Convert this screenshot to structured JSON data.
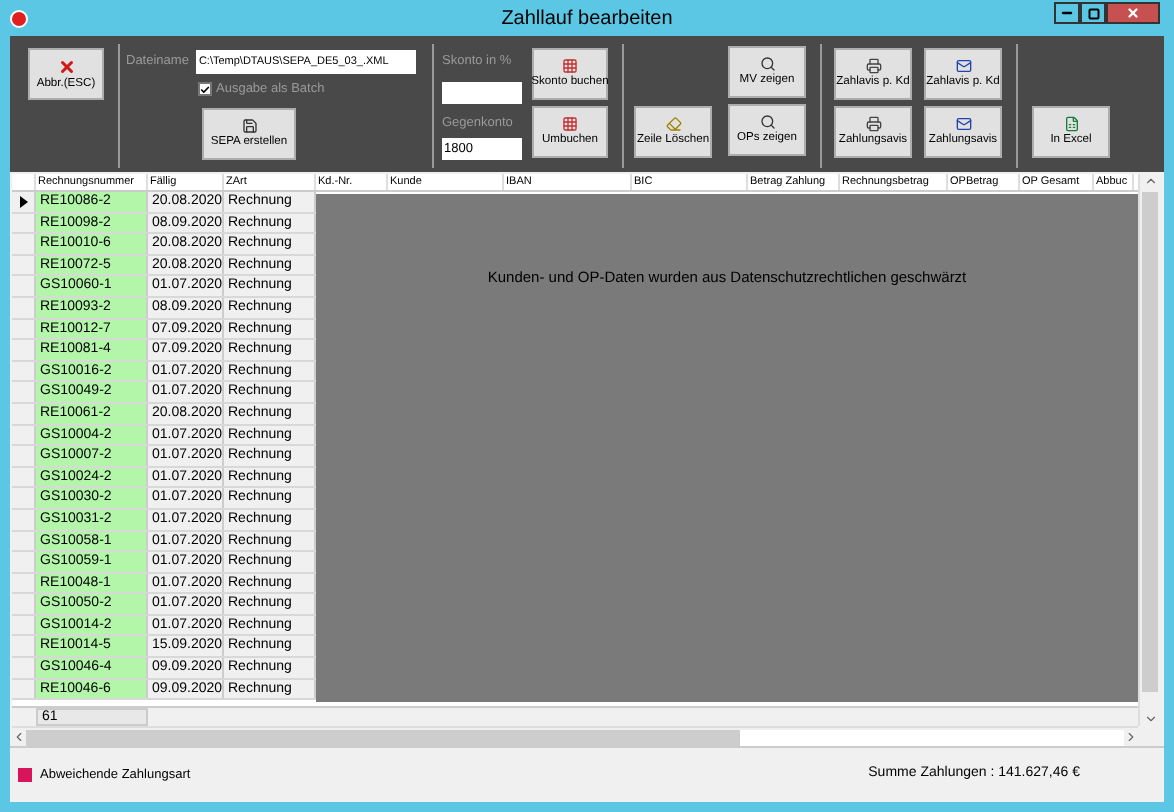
{
  "window": {
    "title": "Zahllauf bearbeiten"
  },
  "toolbar": {
    "cancel_button": "Abbr.(ESC)",
    "filename_label": "Dateiname",
    "filename_value": "C:\\Temp\\DTAUS\\SEPA_DE5_03_.XML",
    "batch_checkbox": {
      "label": "Ausgabe als Batch",
      "checked": true
    },
    "sepa_button": "SEPA erstellen",
    "skonto_label": "Skonto in %",
    "gegenkonto_label": "Gegenkonto",
    "gegenkonto_value": "1800",
    "skonto_button": "Skonto buchen",
    "umbuchen_button": "Umbuchen",
    "delete_row_button": "Zeile Löschen",
    "mv_button": "MV zeigen",
    "ops_button": "OPs zeigen",
    "avis_buttons": [
      {
        "label": "Zahlavis p. Kd",
        "kind": "print"
      },
      {
        "label": "Zahlavis p. Kd",
        "kind": "mail"
      },
      {
        "label": "Zahlungsavis",
        "kind": "print"
      },
      {
        "label": "Zahlungsavis",
        "kind": "mail"
      }
    ],
    "excel_button": "In Excel"
  },
  "table": {
    "columns": [
      "Rechnungsnummer",
      "Fällig",
      "ZArt",
      "Kd.-Nr.",
      "Kunde",
      "IBAN",
      "BIC",
      "Betrag Zahlung",
      "Rechnungsbetrag",
      "OPBetrag",
      "OP Gesamt",
      "Abbuc"
    ],
    "overlay_text": "Kunden- und OP-Daten wurden aus Datenschutzrechtlichen geschwärzt",
    "rows": [
      {
        "number": "RE10086-2",
        "due": "20.08.2020",
        "type": "Rechnung",
        "selected": true
      },
      {
        "number": "RE10098-2",
        "due": "08.09.2020",
        "type": "Rechnung",
        "selected": false
      },
      {
        "number": "RE10010-6",
        "due": "20.08.2020",
        "type": "Rechnung",
        "selected": false
      },
      {
        "number": "RE10072-5",
        "due": "20.08.2020",
        "type": "Rechnung",
        "selected": false
      },
      {
        "number": "GS10060-1",
        "due": "01.07.2020",
        "type": "Rechnung",
        "selected": false
      },
      {
        "number": "RE10093-2",
        "due": "08.09.2020",
        "type": "Rechnung",
        "selected": false
      },
      {
        "number": "RE10012-7",
        "due": "07.09.2020",
        "type": "Rechnung",
        "selected": false
      },
      {
        "number": "RE10081-4",
        "due": "07.09.2020",
        "type": "Rechnung",
        "selected": false
      },
      {
        "number": "GS10016-2",
        "due": "01.07.2020",
        "type": "Rechnung",
        "selected": false
      },
      {
        "number": "GS10049-2",
        "due": "01.07.2020",
        "type": "Rechnung",
        "selected": false
      },
      {
        "number": "RE10061-2",
        "due": "20.08.2020",
        "type": "Rechnung",
        "selected": false
      },
      {
        "number": "GS10004-2",
        "due": "01.07.2020",
        "type": "Rechnung",
        "selected": false
      },
      {
        "number": "GS10007-2",
        "due": "01.07.2020",
        "type": "Rechnung",
        "selected": false
      },
      {
        "number": "GS10024-2",
        "due": "01.07.2020",
        "type": "Rechnung",
        "selected": false
      },
      {
        "number": "GS10030-2",
        "due": "01.07.2020",
        "type": "Rechnung",
        "selected": false
      },
      {
        "number": "GS10031-2",
        "due": "01.07.2020",
        "type": "Rechnung",
        "selected": false
      },
      {
        "number": "GS10058-1",
        "due": "01.07.2020",
        "type": "Rechnung",
        "selected": false
      },
      {
        "number": "GS10059-1",
        "due": "01.07.2020",
        "type": "Rechnung",
        "selected": false
      },
      {
        "number": "RE10048-1",
        "due": "01.07.2020",
        "type": "Rechnung",
        "selected": false
      },
      {
        "number": "GS10050-2",
        "due": "01.07.2020",
        "type": "Rechnung",
        "selected": false
      },
      {
        "number": "GS10014-2",
        "due": "01.07.2020",
        "type": "Rechnung",
        "selected": false
      },
      {
        "number": "RE10014-5",
        "due": "15.09.2020",
        "type": "Rechnung",
        "selected": false
      },
      {
        "number": "GS10046-4",
        "due": "09.09.2020",
        "type": "Rechnung",
        "selected": false
      },
      {
        "number": "RE10046-6",
        "due": "09.09.2020",
        "type": "Rechnung",
        "selected": false
      }
    ],
    "row_count": "61"
  },
  "legend": {
    "label": "Abweichende Zahlungsart",
    "color": "#d8145a"
  },
  "status": {
    "sum": "Summe Zahlungen : 141.627,46 €"
  }
}
